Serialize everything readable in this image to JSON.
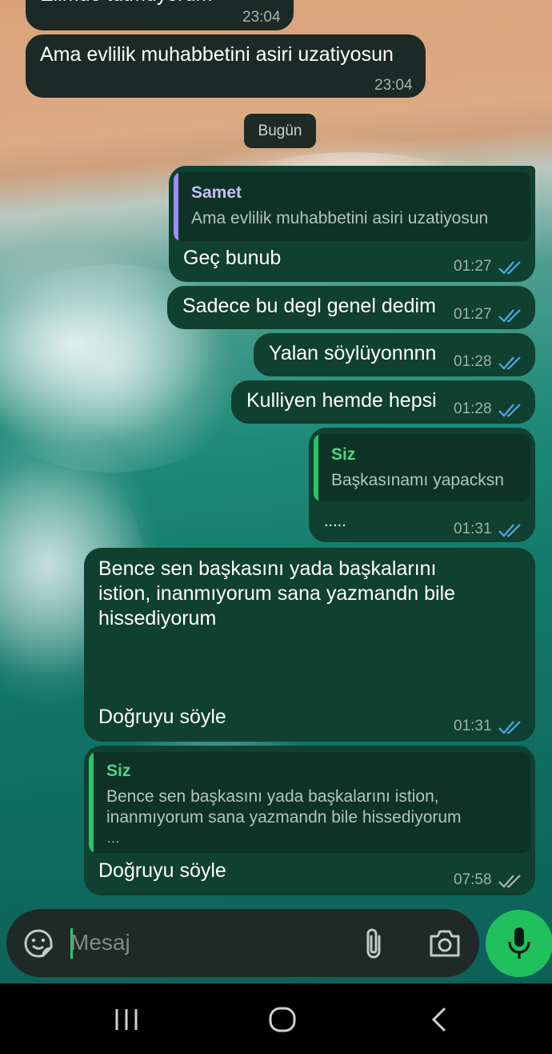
{
  "chat": {
    "messages": [
      {
        "text": "Elimde tutmuyorum",
        "time": "23:04"
      },
      {
        "text": "Ama evlilik muhabbetini asiri uzatiyosun",
        "time": "23:04"
      },
      {
        "reply_name": "Samet",
        "reply_text": "Ama evlilik muhabbetini asiri uzatiyosun",
        "text": "Geç bunub",
        "time": "01:27"
      },
      {
        "text": "Sadece bu degl genel dedim",
        "time": "01:27"
      },
      {
        "text": "Yalan söylüyonnnn",
        "time": "01:28"
      },
      {
        "text": "Kulliyen hemde hepsi",
        "time": "01:28"
      },
      {
        "reply_name": "Siz",
        "reply_text": "Başkasınamı yapacksn",
        "text": ".....",
        "time": "01:31"
      },
      {
        "lines": [
          "Bence sen başkasını yada başkalarını",
          "istion, inanmıyorum sana yazmandn bile",
          "hissediyorum"
        ],
        "last_line": "Doğruyu söyle",
        "time": "01:31"
      },
      {
        "reply_name": "Siz",
        "reply_lines": [
          "Bence sen başkasını yada başkalarını istion,",
          "inanmıyorum sana yazmandn bile hissediyorum",
          "…"
        ],
        "text": "Doğruyu söyle",
        "time": "07:58"
      }
    ],
    "date_separator": "Bugün"
  },
  "composer": {
    "placeholder": "Mesaj",
    "icons": [
      "sticker-icon",
      "paperclip-icon",
      "camera-icon",
      "microphone-icon"
    ]
  },
  "nav": {
    "icons": [
      "recent-apps-icon",
      "home-icon",
      "back-icon"
    ]
  },
  "colors": {
    "outgoing_bubble": "#10402f",
    "incoming_bubble": "#1b2a26",
    "accent": "#20c05c",
    "samet_bar": "#9e8cf0",
    "siz_bar": "#27c46a",
    "tick_blue": "#4ea8e6"
  }
}
